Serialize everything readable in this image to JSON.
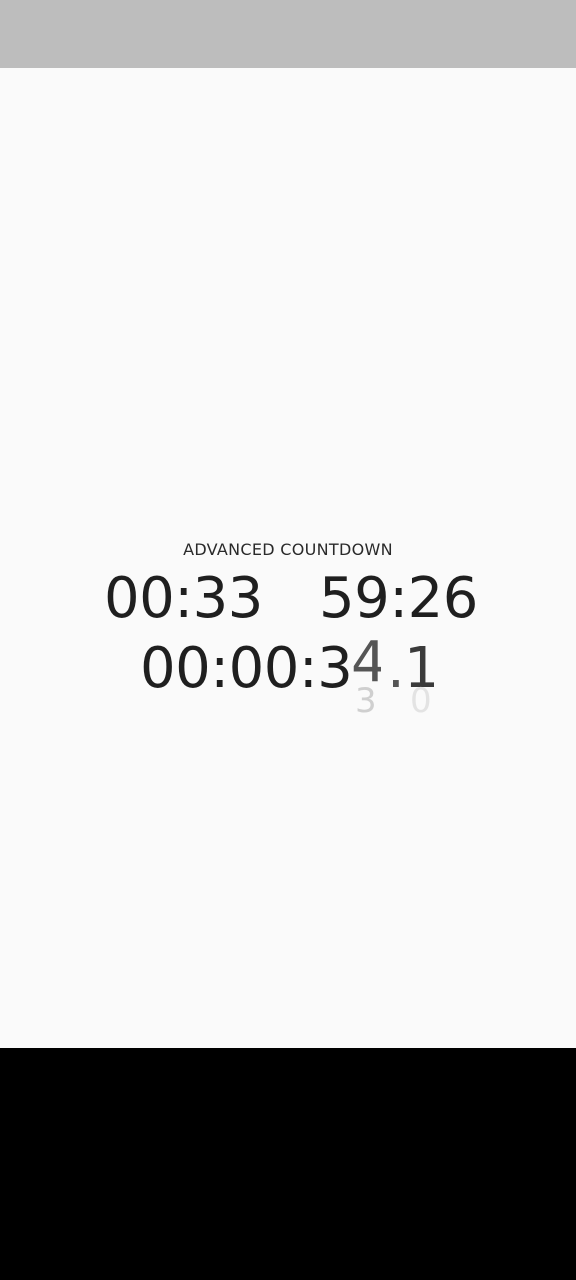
{
  "title": "ADVANCED COUNTDOWN",
  "countdowns": {
    "first": "00:33",
    "second": "59:26",
    "third_prefix": "00:00:3",
    "third_seconds_current": "4",
    "third_seconds_next": "3",
    "third_separator": ".",
    "third_tenths_current": "1",
    "third_tenths_next": "0"
  }
}
